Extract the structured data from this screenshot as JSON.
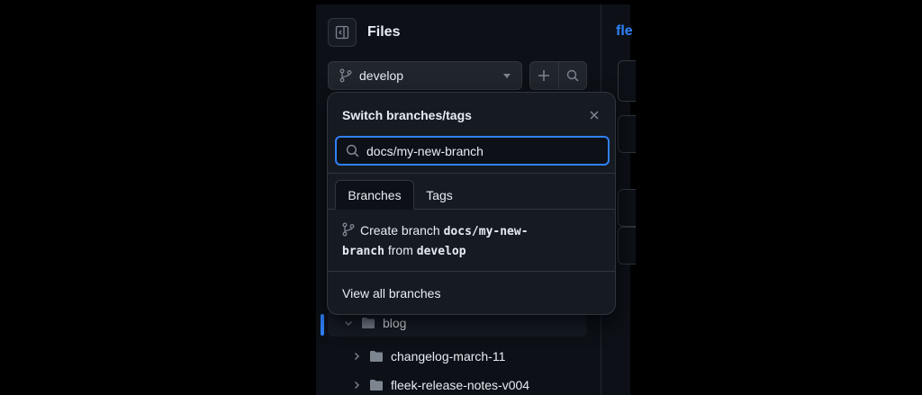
{
  "sidebar": {
    "title": "Files",
    "branch": "develop"
  },
  "right_pane": {
    "title_fragment": "fle"
  },
  "branch_dialog": {
    "title": "Switch branches/tags",
    "search_value": "docs/my-new-branch",
    "tabs": [
      "Branches",
      "Tags"
    ],
    "create_prefix": "Create branch",
    "create_branch": "docs/my-new-branch",
    "create_from": "from",
    "create_source": "develop",
    "view_all": "View all branches"
  },
  "tree": {
    "items": [
      {
        "label": "blog",
        "type": "folder",
        "expanded": true
      },
      {
        "label": "changelog-march-11",
        "type": "folder",
        "expanded": false
      },
      {
        "label": "fleek-release-notes-v004",
        "type": "folder",
        "expanded": false
      }
    ]
  },
  "colors": {
    "accent": "#2f81f7",
    "background": "#0d1117",
    "overlay": "#161b22",
    "border": "#30363d",
    "muted_icon": "#7d8590"
  },
  "icons": [
    "sidebar-collapse-icon",
    "git-branch-icon",
    "caret-down-icon",
    "plus-icon",
    "search-icon",
    "close-icon",
    "chevron-down-icon",
    "chevron-right-icon",
    "folder-icon"
  ]
}
